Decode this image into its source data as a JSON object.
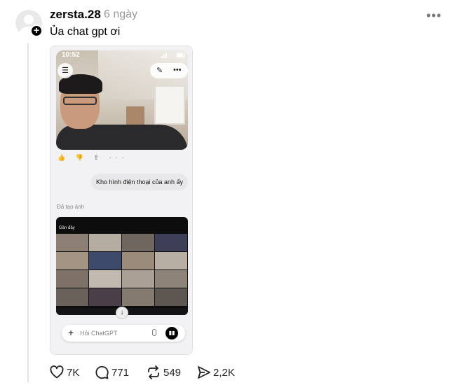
{
  "post": {
    "username": "zersta.28",
    "time": "6 ngày",
    "caption": "Ủa chat gpt ơi",
    "more_label": "•••",
    "follow_label": "+"
  },
  "screenshot": {
    "clock": "10:52",
    "message": "Kho hình điện thoại của anh ấy",
    "created_label": "Đã tạo ảnh",
    "gallery_header": "Gần đây",
    "composer_placeholder": "Hỏi ChatGPT",
    "composer_plus": "+",
    "menu_icon_glyph": "☰",
    "more_glyph": "•••",
    "action_glyphs": "👍 👎 ⇧ ···",
    "scroll_glyph": "↓"
  },
  "engagement": {
    "likes": "7K",
    "comments": "771",
    "reposts": "549",
    "shares": "2,2K"
  },
  "icons": {
    "like": "heart-icon",
    "comment": "comment-bubble-icon",
    "repost": "repost-icon",
    "share": "send-icon"
  }
}
